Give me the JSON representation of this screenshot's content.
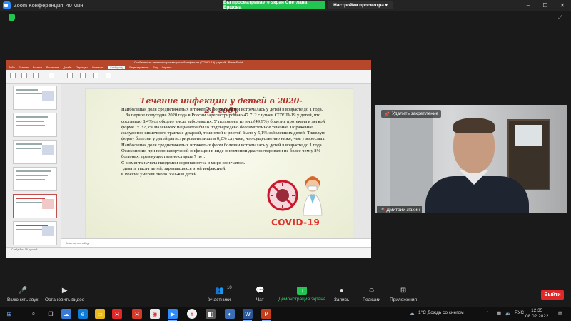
{
  "window": {
    "title": "Zoom Конференция, 40 мин",
    "share_banner": "Вы просматриваете экран Светлана Ершова",
    "view_options": "Настройки просмотра",
    "controls": [
      "–",
      "☐",
      "✕"
    ]
  },
  "ppt": {
    "title": "Особенности течения коронавирусной инфекции (COVID-19) у детей - PowerPoint",
    "tabs": [
      "Файл",
      "Главная",
      "Вставка",
      "Рисование",
      "Дизайн",
      "Переходы",
      "Анимация",
      "Слайд-шоу",
      "Рецензирование",
      "Вид",
      "Справка"
    ],
    "active_tab": "Слайд-шоу",
    "notes_placeholder": "Заметки к слайду",
    "status": "Слайд 8 из 15   русский"
  },
  "slide": {
    "title": "Течение инфекции у детей в 2020-21 году",
    "p1": "Наибольшая доля среднетяжелых и тяжелых форм болезни встречалась у детей в возрасте до 1 года.",
    "p2": "За первое полугодие 2020 года в России зарегистрировано 47 712 случаев COVID-19 у детей, что составило 8,4% от общего числа заболевших. У половины из них (49,9%) болезнь протекала в легкой форме. У 32,3% маленьких пациентов было подтверждено бессимптомное течение.     Поражение желудочно-кишечного тракта с диареей, тошнотой и рвотой было у 5,1% заболевших детей. Тяжелую форму болезни у детей регистрировали лишь в 0,2% случаев, что существенно ниже, чем у взрослых. Наибольшая доля среднетяжелых и тяжелых форм болезни встречалась у детей в возрасте до 1 года. Осложнения при",
    "p2_underlined": "коронавирусной",
    "p2_end": "инфекции в виде пневмонии диагностировали не более чем у 8% больных, преимущественно старше 7 лет.",
    "p3_start": "С момента начала пандемии",
    "p3_underlined": "коронавируса",
    "p3_end": "в мире скончалось",
    "p4": "девять тысяч детей, заразившихся этой инфекцией,",
    "p5": "в России умерли около 350-400 детей.",
    "covid_label": "COVID-19"
  },
  "video": {
    "unpin_label": "Удалить закрепление",
    "participant_name": "Дмитрий Лахин"
  },
  "toolbar": {
    "mute": "Включить звук",
    "video": "Остановить видео",
    "participants": "Участники",
    "participants_count": "10",
    "chat": "Чат",
    "share": "Демонстрация экрана",
    "record": "Запись",
    "reactions": "Реакции",
    "apps": "Приложения",
    "leave": "Выйти"
  },
  "taskbar": {
    "weather": "1°C  Дождь со снегом",
    "lang": "РУС",
    "time": "12:35",
    "date": "08.02.2022"
  }
}
